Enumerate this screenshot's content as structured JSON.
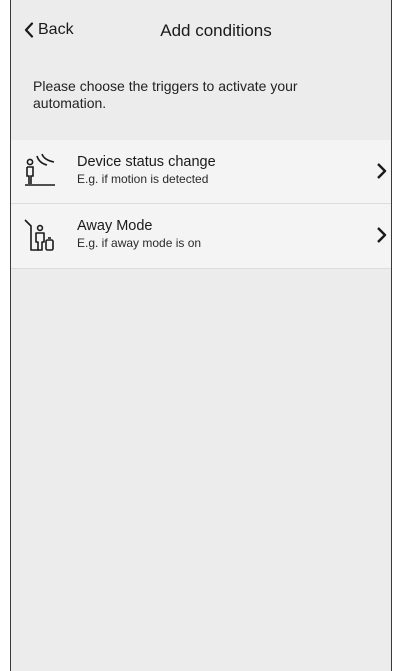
{
  "header": {
    "back_label": "Back",
    "title": "Add conditions",
    "back_icon": "chevron-left-icon"
  },
  "intro": {
    "text": "Please choose the triggers to activate your automation."
  },
  "conditions": [
    {
      "title": "Device status change",
      "subtitle": "E.g. if motion is detected",
      "icon": "motion-sensor-icon"
    },
    {
      "title": "Away Mode",
      "subtitle": "E.g. if away mode is on",
      "icon": "away-mode-icon"
    }
  ],
  "colors": {
    "background": "#ececec",
    "row_background": "#f4f4f4",
    "text": "#1a1a1a"
  }
}
